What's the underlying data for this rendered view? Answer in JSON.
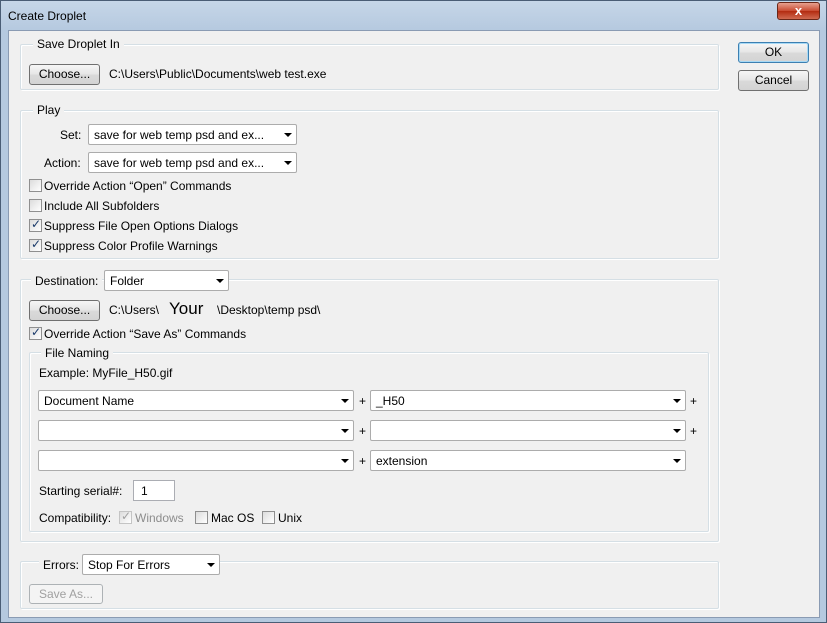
{
  "window": {
    "title": "Create Droplet",
    "close_glyph": "x"
  },
  "buttons": {
    "ok": "OK",
    "cancel": "Cancel"
  },
  "save_in": {
    "legend": "Save Droplet In",
    "choose": "Choose...",
    "path": "C:\\Users\\Public\\Documents\\web test.exe"
  },
  "play": {
    "legend": "Play",
    "set_label": "Set:",
    "set_value": "save for web temp psd and ex...",
    "action_label": "Action:",
    "action_value": "save for web temp psd and ex...",
    "options": [
      {
        "label": "Override Action “Open” Commands",
        "checked": false
      },
      {
        "label": "Include All Subfolders",
        "checked": false
      },
      {
        "label": "Suppress File Open Options Dialogs",
        "checked": true
      },
      {
        "label": "Suppress Color Profile Warnings",
        "checked": true
      }
    ]
  },
  "destination": {
    "label": "Destination:",
    "value": "Folder",
    "choose": "Choose...",
    "path_prefix": "C:\\Users\\",
    "path_user": "Your",
    "path_suffix": "\\Desktop\\temp psd\\",
    "override_save_as": {
      "label": "Override Action “Save As” Commands",
      "checked": true
    }
  },
  "file_naming": {
    "legend": "File Naming",
    "example": "Example: MyFile_H50.gif",
    "fields": [
      [
        "Document Name",
        "_H50"
      ],
      [
        "",
        ""
      ],
      [
        "",
        "extension"
      ]
    ],
    "plus": "+",
    "serial_label": "Starting serial#:",
    "serial_value": "1",
    "compat_label": "Compatibility:",
    "compat": [
      {
        "label": "Windows",
        "checked": true,
        "disabled": true
      },
      {
        "label": "Mac OS",
        "checked": false,
        "disabled": false
      },
      {
        "label": "Unix",
        "checked": false,
        "disabled": false
      }
    ]
  },
  "errors": {
    "label": "Errors:",
    "value": "Stop For Errors",
    "save_as": "Save As..."
  }
}
